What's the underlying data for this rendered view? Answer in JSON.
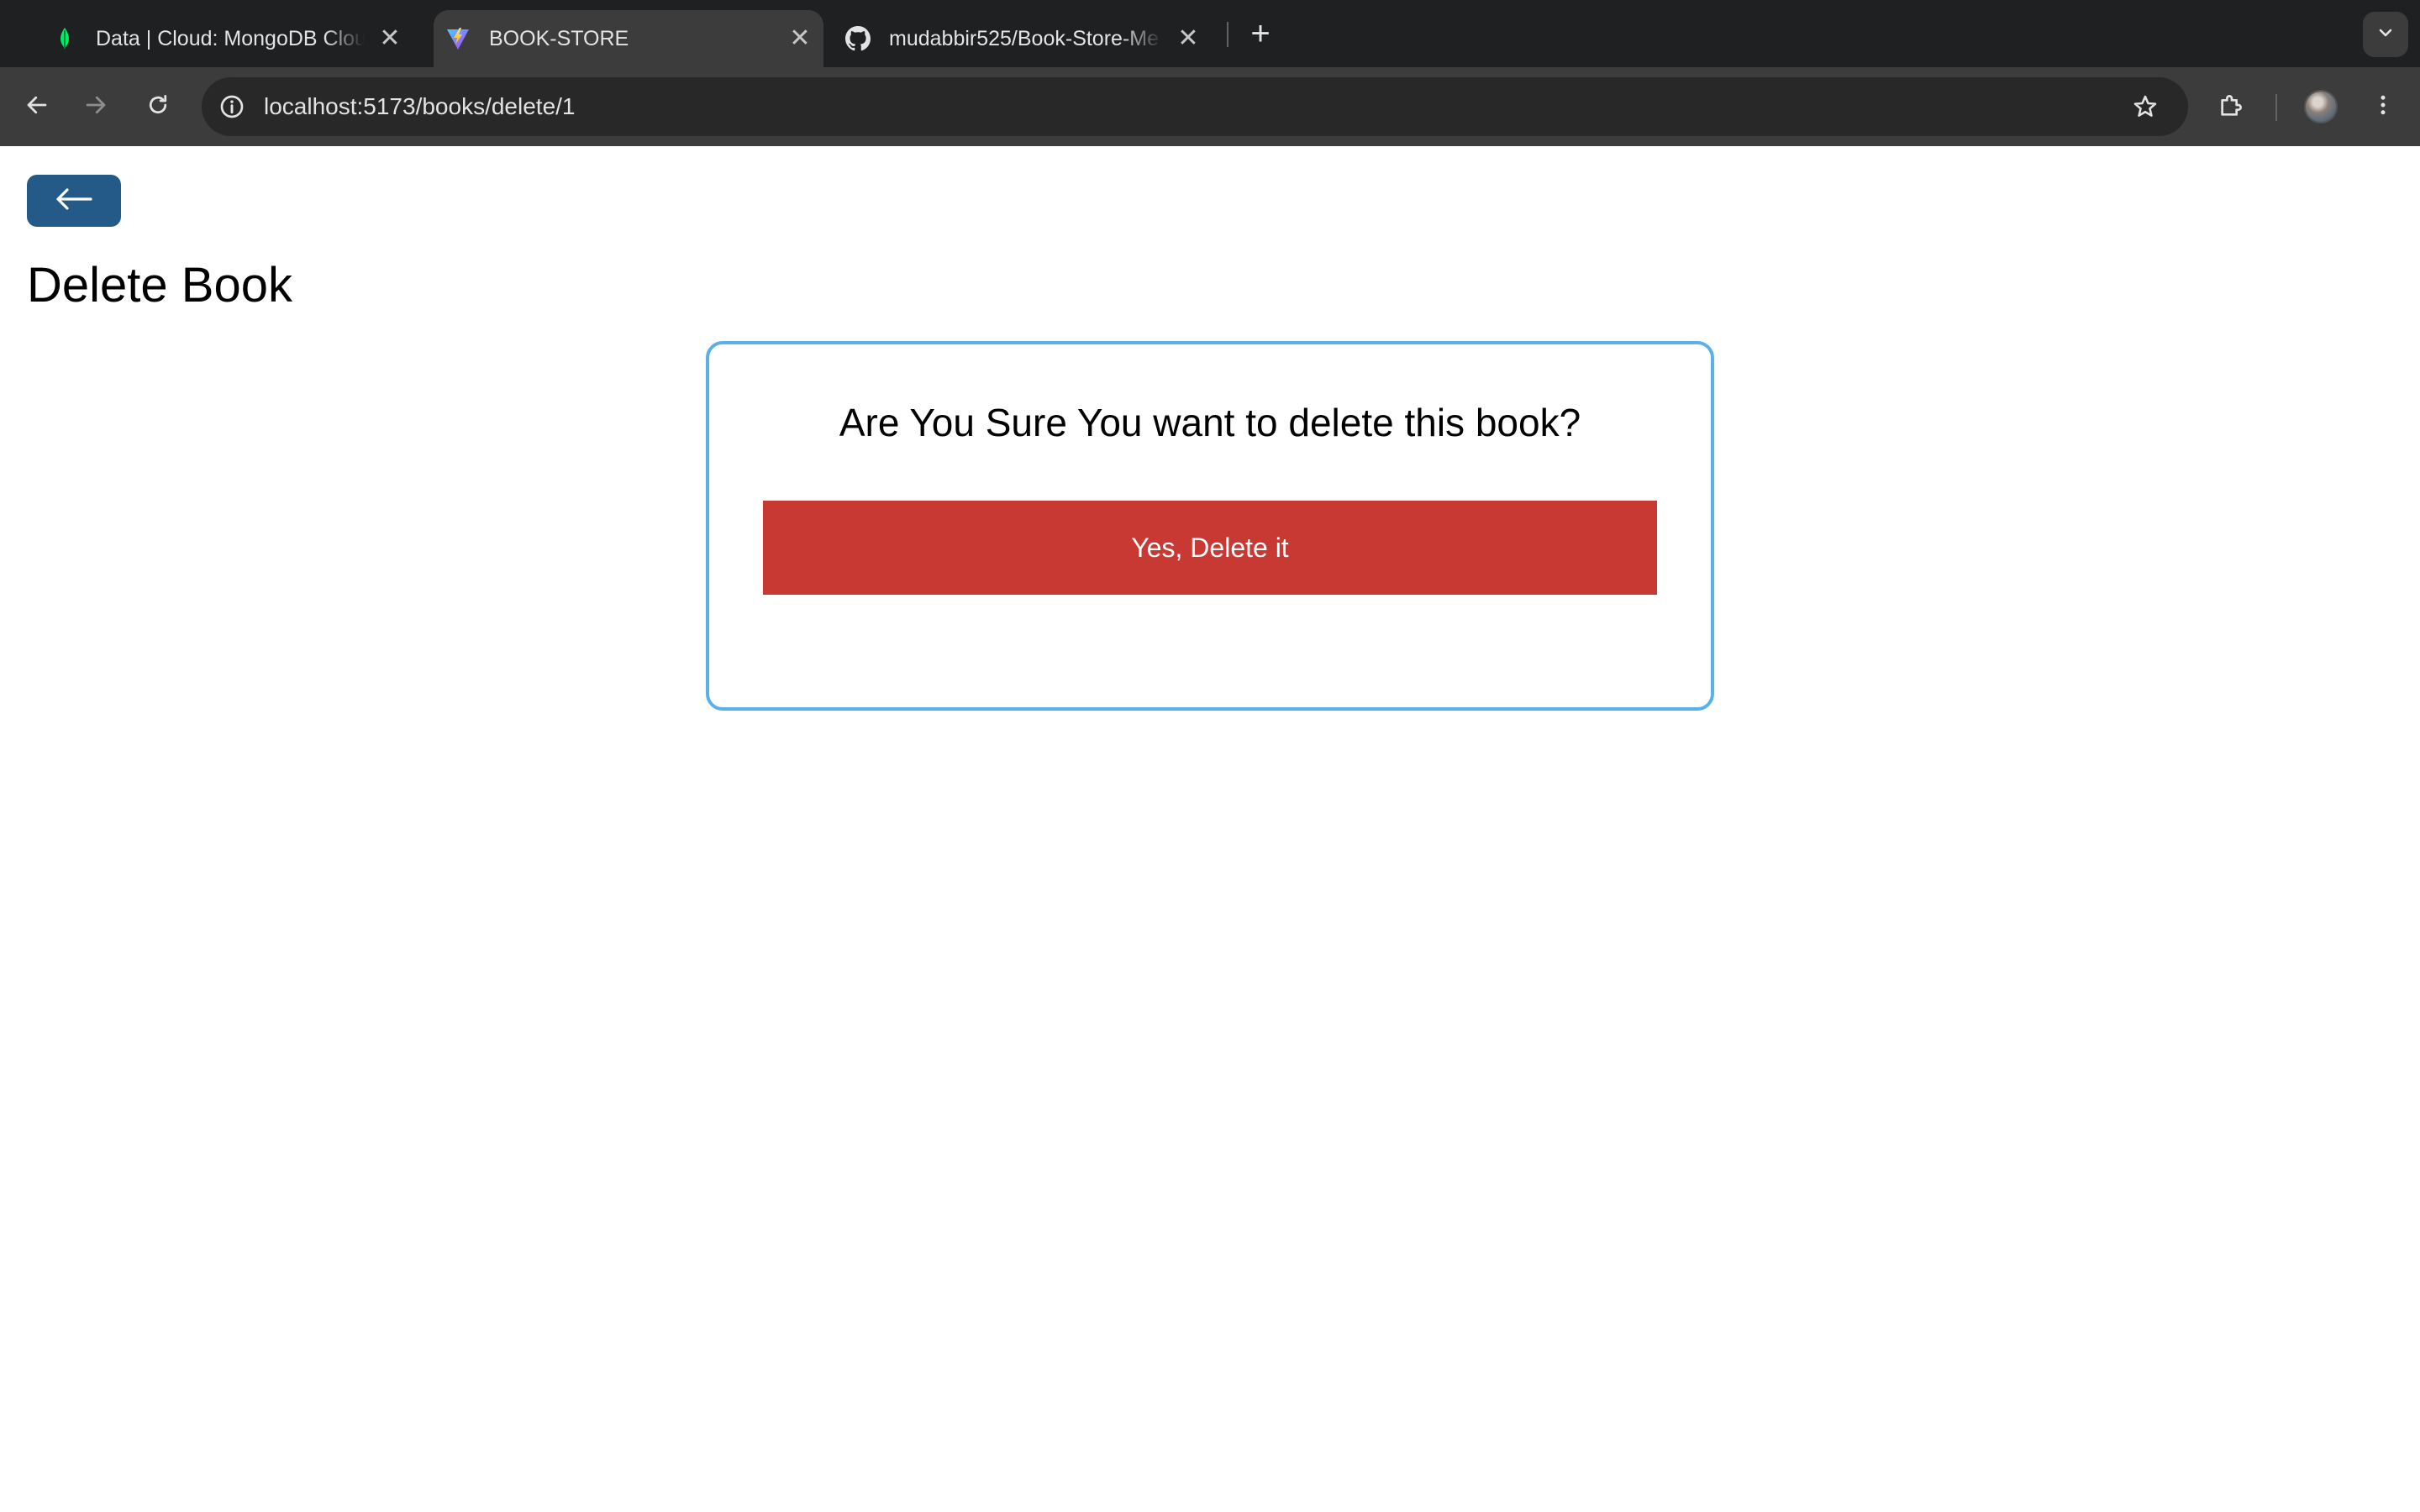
{
  "browser": {
    "tabs": [
      {
        "title": "Data | Cloud: MongoDB Cloud",
        "favicon": "mongodb-leaf-icon",
        "active": false
      },
      {
        "title": "BOOK-STORE",
        "favicon": "vite-logo-icon",
        "active": true
      },
      {
        "title": "mudabbir525/Book-Store-Me",
        "favicon": "github-icon",
        "active": false
      }
    ],
    "new_tab_label": "+",
    "tab_close_glyph": "✕",
    "address_bar": {
      "url": "localhost:5173/books/delete/1"
    },
    "colors": {
      "tabstrip": "#1f2021",
      "toolbar": "#3c3c3c",
      "omnibox": "#282828"
    }
  },
  "page": {
    "back_button_icon": "arrow-left-icon",
    "title": "Delete Book",
    "confirm": {
      "question": "Are You Sure You want to delete this book?",
      "button_label": "Yes, Delete it"
    },
    "colors": {
      "back_button": "#245a87",
      "card_border": "#5ab0e8",
      "delete_button": "#c93933"
    }
  }
}
